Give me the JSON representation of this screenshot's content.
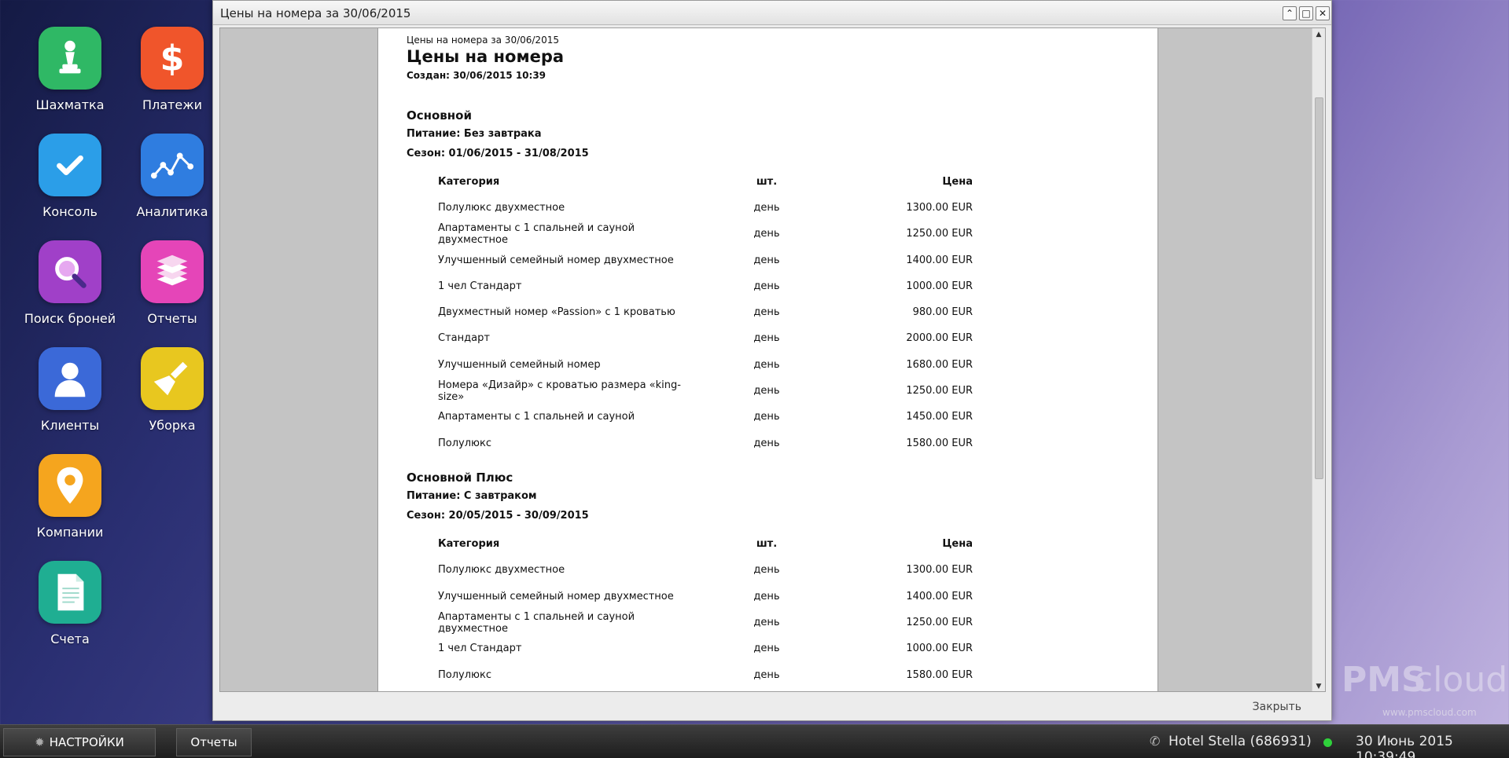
{
  "desktop": {
    "apps": [
      {
        "label": "Шахматка",
        "icon": "chess-pawn-icon",
        "color": "#2fb865"
      },
      {
        "label": "Платежи",
        "icon": "dollar-icon",
        "color": "#f0552b"
      },
      {
        "label": "Консоль",
        "icon": "check-icon",
        "color": "#2b9ee8"
      },
      {
        "label": "Аналитика",
        "icon": "line-chart-icon",
        "color": "#2f7de0"
      },
      {
        "label": "Поиск броней",
        "icon": "magnifier-icon",
        "color": "#a040c8"
      },
      {
        "label": "Отчеты",
        "icon": "books-icon",
        "color": "#e545b8"
      },
      {
        "label": "Клиенты",
        "icon": "user-icon",
        "color": "#3b69d8"
      },
      {
        "label": "Уборка",
        "icon": "broom-icon",
        "color": "#e8c71f"
      },
      {
        "label": "Компании",
        "icon": "map-pin-icon",
        "color": "#f5a51e"
      },
      {
        "label": "Счета",
        "icon": "document-icon",
        "color": "#1fae92"
      }
    ]
  },
  "window": {
    "title": "Цены на номера за 30/06/2015",
    "close_label": "Закрыть"
  },
  "report": {
    "small_title": "Цены на номера за 30/06/2015",
    "title": "Цены на номера",
    "created": "Создан: 30/06/2015 10:39",
    "columns": {
      "category": "Категория",
      "unit": "шт.",
      "price": "Цена"
    },
    "sections": [
      {
        "name": "Основной",
        "meal": "Питание: Без завтрака",
        "season": "Сезон: 01/06/2015 - 31/08/2015",
        "rows": [
          {
            "category": "Полулюкс двухместное",
            "unit": "день",
            "price": "1300.00 EUR"
          },
          {
            "category": "Апартаменты с 1 спальней и сауной двухместное",
            "unit": "день",
            "price": "1250.00 EUR"
          },
          {
            "category": "Улучшенный семейный номер двухместное",
            "unit": "день",
            "price": "1400.00 EUR"
          },
          {
            "category": "1 чел Стандарт",
            "unit": "день",
            "price": "1000.00 EUR"
          },
          {
            "category": "Двухместный номер «Passion» с 1 кроватью",
            "unit": "день",
            "price": "980.00 EUR"
          },
          {
            "category": "Стандарт",
            "unit": "день",
            "price": "2000.00 EUR"
          },
          {
            "category": "Улучшенный семейный номер",
            "unit": "день",
            "price": "1680.00 EUR"
          },
          {
            "category": "Номера «Дизайр» с кроватью размера «king-size»",
            "unit": "день",
            "price": "1250.00 EUR"
          },
          {
            "category": "Апартаменты с 1 спальней и сауной",
            "unit": "день",
            "price": "1450.00 EUR"
          },
          {
            "category": "Полулюкс",
            "unit": "день",
            "price": "1580.00 EUR"
          }
        ]
      },
      {
        "name": "Основной Плюс",
        "meal": "Питание: С завтраком",
        "season": "Сезон: 20/05/2015 - 30/09/2015",
        "rows": [
          {
            "category": "Полулюкс двухместное",
            "unit": "день",
            "price": "1300.00 EUR"
          },
          {
            "category": "Улучшенный семейный номер двухместное",
            "unit": "день",
            "price": "1400.00 EUR"
          },
          {
            "category": "Апартаменты с 1 спальней и сауной двухместное",
            "unit": "день",
            "price": "1250.00 EUR"
          },
          {
            "category": "1 чел Стандарт",
            "unit": "день",
            "price": "1000.00 EUR"
          },
          {
            "category": "Полулюкс",
            "unit": "день",
            "price": "1580.00 EUR"
          }
        ]
      }
    ]
  },
  "taskbar": {
    "settings_label": "НАСТРОЙКИ",
    "task_label": "Отчеты",
    "hotel": "Hotel Stella (686931)",
    "datetime": "30 Июнь 2015 10:39:49"
  },
  "logo": {
    "brand1": "PMS",
    "brand2": "cloud",
    "url": "www.pmscloud.com"
  }
}
